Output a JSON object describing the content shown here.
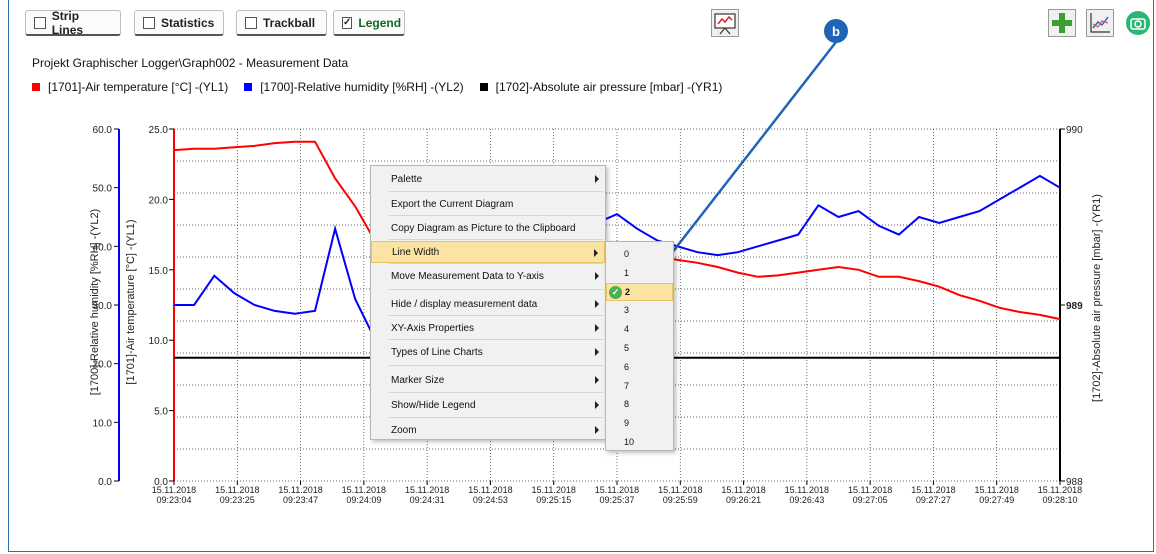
{
  "toolbar": {
    "strip_lines": {
      "label": "Strip Lines",
      "checked": false
    },
    "statistics": {
      "label": "Statistics",
      "checked": false
    },
    "trackball": {
      "label": "Trackball",
      "checked": false
    },
    "legend": {
      "label": "Legend",
      "checked": true
    },
    "check_glyph": "✓"
  },
  "diagram": {
    "title": "Projekt Graphischer Logger\\Graph002  - Measurement Data",
    "legend": [
      {
        "label": "[1701]-Air temperature [°C] -(YL1)",
        "color": "#ff0000"
      },
      {
        "label": "[1700]-Relative humidity [%RH] -(YL2)",
        "color": "#0000ff"
      },
      {
        "label": "[1702]-Absolute air pressure [mbar] -(YR1)",
        "color": "#000000"
      }
    ],
    "axes": {
      "yl2_title": "[1700]-Relative humidity [%RH] -(YL2)",
      "yl1_title": "[1701]-Air temperature [°C] -(YL1)",
      "yr1_title": "[1702]-Absolute air pressure [mbar] -(YR1)",
      "yl2_ticks": [
        "60.0",
        "50.0",
        "40.0",
        "30.0",
        "20.0",
        "10.0",
        "0.0"
      ],
      "yl1_ticks": [
        "25.0",
        "20.0",
        "15.0",
        "10.0",
        "5.0",
        "0.0"
      ],
      "yr1_ticks": [
        "990",
        "989",
        "988"
      ],
      "x_ticks": [
        [
          "15.11.2018",
          "09:23:04"
        ],
        [
          "15.11.2018",
          "09:23:25"
        ],
        [
          "15.11.2018",
          "09:23:47"
        ],
        [
          "15.11.2018",
          "09:24:09"
        ],
        [
          "15.11.2018",
          "09:24:31"
        ],
        [
          "15.11.2018",
          "09:24:53"
        ],
        [
          "15.11.2018",
          "09:25:15"
        ],
        [
          "15.11.2018",
          "09:25:37"
        ],
        [
          "15.11.2018",
          "09:25:59"
        ],
        [
          "15.11.2018",
          "09:26:21"
        ],
        [
          "15.11.2018",
          "09:26:43"
        ],
        [
          "15.11.2018",
          "09:27:05"
        ],
        [
          "15.11.2018",
          "09:27:27"
        ],
        [
          "15.11.2018",
          "09:27:49"
        ],
        [
          "15.11.2018",
          "09:28:10"
        ]
      ]
    }
  },
  "series": {
    "temperature": [
      23.5,
      23.6,
      23.6,
      23.7,
      23.8,
      24.0,
      24.1,
      24.1,
      21.5,
      19.5,
      17.0,
      15.5,
      15.0,
      15.2,
      15.5,
      16.0,
      16.5,
      17.0,
      17.3,
      17.2,
      17.0,
      16.5,
      16.0,
      16.0,
      16.0,
      15.7,
      15.5,
      15.2,
      14.8,
      14.5,
      14.6,
      14.8,
      15.0,
      15.2,
      15.0,
      14.5,
      14.5,
      14.2,
      13.8,
      13.2,
      12.8,
      12.3,
      12.0,
      11.8,
      11.5
    ],
    "humidity": [
      30.0,
      30.0,
      35.0,
      32.0,
      30.0,
      29.0,
      28.5,
      29.0,
      43.0,
      31.0,
      24.0,
      25.0,
      29.0,
      34.0,
      37.0,
      38.5,
      39.0,
      38.0,
      37.0,
      37.5,
      39.0,
      44.0,
      45.5,
      43.0,
      41.0,
      40.0,
      39.0,
      38.5,
      39.0,
      40.0,
      41.0,
      42.0,
      47.0,
      45.0,
      46.0,
      43.5,
      42.0,
      45.0,
      44.0,
      45.0,
      46.0,
      48.0,
      50.0,
      52.0,
      50.0
    ],
    "pressure_mbar": 988.7
  },
  "context_menu": {
    "items": [
      {
        "label": "Palette",
        "submenu": true
      },
      {
        "label": "Export the Current Diagram",
        "submenu": false
      },
      {
        "label": "Copy Diagram as Picture to the Clipboard",
        "submenu": false
      },
      {
        "label": "Line Width",
        "submenu": true,
        "highlighted": true
      },
      {
        "label": "Move Measurement Data to Y-axis",
        "submenu": true
      },
      {
        "label": "Hide / display measurement data",
        "submenu": true
      },
      {
        "label": "XY-Axis Properties",
        "submenu": true
      },
      {
        "label": "Types of Line Charts",
        "submenu": true
      },
      {
        "label": "Marker Size",
        "submenu": true
      },
      {
        "label": "Show/Hide Legend",
        "submenu": true
      },
      {
        "label": "Zoom",
        "submenu": true
      }
    ]
  },
  "line_width_submenu": {
    "options": [
      "0",
      "1",
      "2",
      "3",
      "4",
      "5",
      "6",
      "7",
      "8",
      "9",
      "10"
    ],
    "selected": "2"
  },
  "annotation": {
    "badge": "b",
    "color": "#1f64b5"
  }
}
